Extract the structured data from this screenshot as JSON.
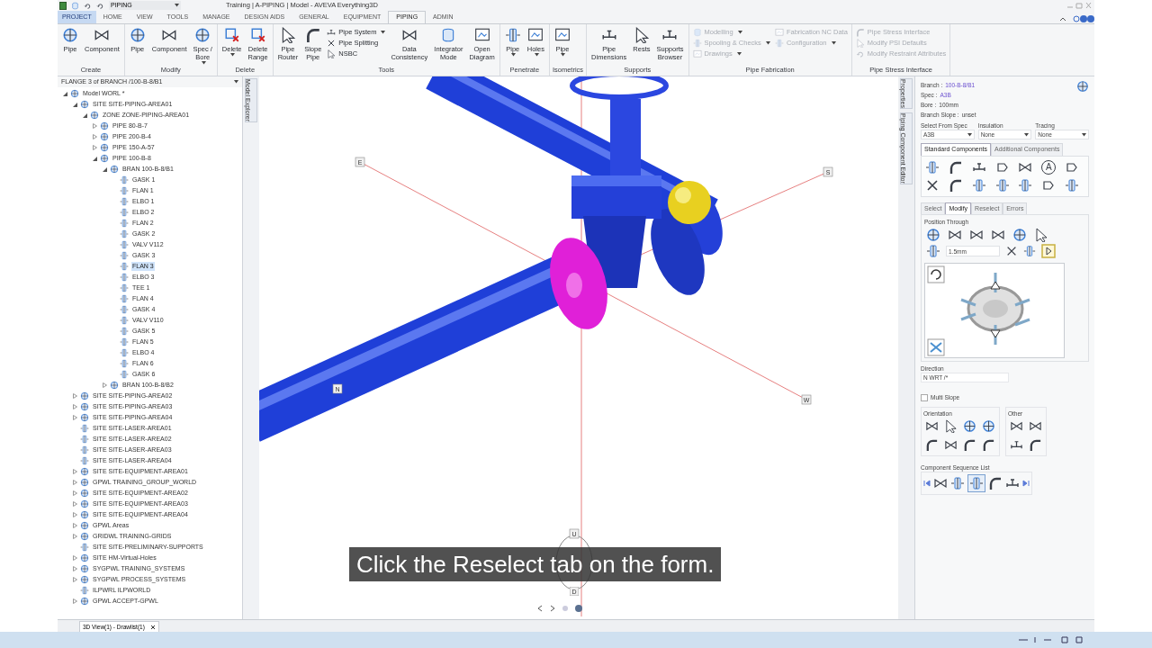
{
  "title_bar": {
    "workspace": "PIPING",
    "title": "Training | A-PIPING | Model - AVEVA Everything3D"
  },
  "tabs": [
    {
      "label": "PROJECT",
      "kind": "app"
    },
    {
      "label": "HOME",
      "kind": "tab",
      "selected": false
    },
    {
      "label": "VIEW",
      "kind": "tab",
      "selected": false
    },
    {
      "label": "TOOLS",
      "kind": "tab",
      "selected": false
    },
    {
      "label": "MANAGE",
      "kind": "tab",
      "selected": false
    },
    {
      "label": "DESIGN AIDS",
      "kind": "tab",
      "selected": false
    },
    {
      "label": "GENERAL",
      "kind": "tab",
      "selected": false
    },
    {
      "label": "EQUIPMENT",
      "kind": "tab",
      "selected": false
    },
    {
      "label": "PIPING",
      "kind": "tab",
      "selected": true
    },
    {
      "label": "ADMIN",
      "kind": "tab",
      "selected": false
    }
  ],
  "ribbon": [
    {
      "label": "Create",
      "items": [
        {
          "kind": "large",
          "label": "Pipe",
          "menu": false,
          "disabled": false
        },
        {
          "kind": "large",
          "label": "Component",
          "menu": false,
          "disabled": false
        }
      ]
    },
    {
      "label": "Modify",
      "items": [
        {
          "kind": "large",
          "label": "Pipe",
          "menu": false,
          "disabled": false
        },
        {
          "kind": "large",
          "label": "Component",
          "menu": false,
          "disabled": false
        },
        {
          "kind": "large",
          "label": "Spec /\nBore",
          "menu": true,
          "disabled": false
        }
      ]
    },
    {
      "label": "Delete",
      "items": [
        {
          "kind": "large",
          "label": "Delete",
          "menu": true,
          "disabled": false
        },
        {
          "kind": "large",
          "label": "Delete\nRange",
          "menu": false,
          "disabled": false
        }
      ]
    },
    {
      "label": "Tools",
      "items": [
        {
          "kind": "large",
          "label": "Pipe\nRouter",
          "menu": false,
          "disabled": false
        },
        {
          "kind": "large",
          "label": "Slope\nPipe",
          "menu": false,
          "disabled": false
        },
        {
          "kind": "small",
          "label": "Pipe System",
          "menu": true,
          "disabled": false
        },
        {
          "kind": "small",
          "label": "Pipe Splitting",
          "menu": false,
          "disabled": false
        },
        {
          "kind": "small",
          "label": "NSBC",
          "menu": false,
          "disabled": false
        },
        {
          "kind": "large",
          "label": "Data\nConsistency",
          "menu": false,
          "disabled": false
        },
        {
          "kind": "large",
          "label": "Integrator\nMode",
          "menu": false,
          "disabled": false
        },
        {
          "kind": "large",
          "label": "Open\nDiagram",
          "menu": false,
          "disabled": false
        }
      ]
    },
    {
      "label": "Penetrate",
      "items": [
        {
          "kind": "large",
          "label": "Pipe",
          "menu": true,
          "disabled": false
        },
        {
          "kind": "large",
          "label": "Holes",
          "menu": true,
          "disabled": false
        }
      ]
    },
    {
      "label": "Isometrics",
      "items": [
        {
          "kind": "large",
          "label": "Pipe",
          "menu": true,
          "disabled": false
        }
      ]
    },
    {
      "label": "Supports",
      "items": [
        {
          "kind": "large",
          "label": "Pipe\nDimensions",
          "menu": false,
          "disabled": false
        },
        {
          "kind": "large",
          "label": "Rests",
          "menu": false,
          "disabled": false
        },
        {
          "kind": "large",
          "label": "Supports\nBrowser",
          "menu": false,
          "disabled": false
        }
      ]
    },
    {
      "label": "Pipe Fabrication",
      "items": [
        {
          "kind": "small",
          "label": "Modelling",
          "menu": true,
          "disabled": true
        },
        {
          "kind": "small",
          "label": "Spooling & Checks",
          "menu": true,
          "disabled": true
        },
        {
          "kind": "small",
          "label": "Drawings",
          "menu": true,
          "disabled": true
        },
        {
          "kind": "small",
          "label": "Fabrication NC Data",
          "menu": false,
          "disabled": true
        },
        {
          "kind": "small",
          "label": "Configuration",
          "menu": true,
          "disabled": true
        }
      ]
    },
    {
      "label": "Pipe Stress Interface",
      "items": [
        {
          "kind": "small",
          "label": "Pipe Stress Interface",
          "menu": false,
          "disabled": true
        },
        {
          "kind": "small",
          "label": "Modify PSI Defaults",
          "menu": false,
          "disabled": true
        },
        {
          "kind": "small",
          "label": "Modify Restraint Attributes",
          "menu": false,
          "disabled": true
        }
      ]
    }
  ],
  "explorer": {
    "header": "FLANGE 3 of BRANCH /100-B-8/B1",
    "side_tab": "Model Explorer",
    "tree": [
      {
        "label": "Model WORL *",
        "kind": "branch",
        "expanded": true,
        "selected": false,
        "children": [
          {
            "label": "SITE SITE-PIPING-AREA01",
            "kind": "branch",
            "expanded": true,
            "selected": false,
            "children": [
              {
                "label": "ZONE ZONE-PIPING-AREA01",
                "kind": "branch",
                "expanded": true,
                "selected": false,
                "children": [
                  {
                    "label": "PIPE 80-B-7",
                    "kind": "branch",
                    "expanded": false,
                    "selected": false
                  },
                  {
                    "label": "PIPE 200-B-4",
                    "kind": "branch",
                    "expanded": false,
                    "selected": false
                  },
                  {
                    "label": "PIPE 150-A-57",
                    "kind": "branch",
                    "expanded": false,
                    "selected": false
                  },
                  {
                    "label": "PIPE 100-B-8",
                    "kind": "branch",
                    "expanded": true,
                    "selected": false,
                    "children": [
                      {
                        "label": "BRAN 100-B-8/B1",
                        "kind": "branch",
                        "expanded": true,
                        "selected": false,
                        "children": [
                          {
                            "label": "GASK 1",
                            "kind": "leaf",
                            "selected": false
                          },
                          {
                            "label": "FLAN 1",
                            "kind": "leaf",
                            "selected": false
                          },
                          {
                            "label": "ELBO 1",
                            "kind": "leaf",
                            "selected": false
                          },
                          {
                            "label": "ELBO 2",
                            "kind": "leaf",
                            "selected": false
                          },
                          {
                            "label": "FLAN 2",
                            "kind": "leaf",
                            "selected": false
                          },
                          {
                            "label": "GASK 2",
                            "kind": "leaf",
                            "selected": false
                          },
                          {
                            "label": "VALV V112",
                            "kind": "leaf",
                            "selected": false
                          },
                          {
                            "label": "GASK 3",
                            "kind": "leaf",
                            "selected": false
                          },
                          {
                            "label": "FLAN 3",
                            "kind": "leaf",
                            "selected": true
                          },
                          {
                            "label": "ELBO 3",
                            "kind": "leaf",
                            "selected": false
                          },
                          {
                            "label": "TEE 1",
                            "kind": "leaf",
                            "selected": false
                          },
                          {
                            "label": "FLAN 4",
                            "kind": "leaf",
                            "selected": false
                          },
                          {
                            "label": "GASK 4",
                            "kind": "leaf",
                            "selected": false
                          },
                          {
                            "label": "VALV V110",
                            "kind": "leaf",
                            "selected": false
                          },
                          {
                            "label": "GASK 5",
                            "kind": "leaf",
                            "selected": false
                          },
                          {
                            "label": "FLAN 5",
                            "kind": "leaf",
                            "selected": false
                          },
                          {
                            "label": "ELBO 4",
                            "kind": "leaf",
                            "selected": false
                          },
                          {
                            "label": "FLAN 6",
                            "kind": "leaf",
                            "selected": false
                          },
                          {
                            "label": "GASK 6",
                            "kind": "leaf",
                            "selected": false
                          }
                        ]
                      },
                      {
                        "label": "BRAN 100-B-8/B2",
                        "kind": "branch",
                        "expanded": false,
                        "selected": false
                      }
                    ]
                  }
                ]
              }
            ]
          },
          {
            "label": "SITE SITE-PIPING-AREA02",
            "kind": "branch",
            "expanded": false,
            "selected": false
          },
          {
            "label": "SITE SITE-PIPING-AREA03",
            "kind": "branch",
            "expanded": false,
            "selected": false
          },
          {
            "label": "SITE SITE-PIPING-AREA04",
            "kind": "branch",
            "expanded": false,
            "selected": false
          },
          {
            "label": "SITE SITE-LASER-AREA01",
            "kind": "leaf",
            "selected": false
          },
          {
            "label": "SITE SITE-LASER-AREA02",
            "kind": "leaf",
            "selected": false
          },
          {
            "label": "SITE SITE-LASER-AREA03",
            "kind": "leaf",
            "selected": false
          },
          {
            "label": "SITE SITE-LASER-AREA04",
            "kind": "leaf",
            "selected": false
          },
          {
            "label": "SITE SITE-EQUIPMENT-AREA01",
            "kind": "branch",
            "expanded": false,
            "selected": false
          },
          {
            "label": "GPWL TRAINING_GROUP_WORLD",
            "kind": "branch",
            "expanded": false,
            "selected": false
          },
          {
            "label": "SITE SITE-EQUIPMENT-AREA02",
            "kind": "branch",
            "expanded": false,
            "selected": false
          },
          {
            "label": "SITE SITE-EQUIPMENT-AREA03",
            "kind": "branch",
            "expanded": false,
            "selected": false
          },
          {
            "label": "SITE SITE-EQUIPMENT-AREA04",
            "kind": "branch",
            "expanded": false,
            "selected": false
          },
          {
            "label": "GPWL Areas",
            "kind": "branch",
            "expanded": false,
            "selected": false
          },
          {
            "label": "GRIDWL TRAINING-GRIDS",
            "kind": "branch",
            "expanded": false,
            "selected": false
          },
          {
            "label": "SITE SITE-PRELIMINARY-SUPPORTS",
            "kind": "leaf",
            "selected": false
          },
          {
            "label": "SITE HM-Virtual-Holes",
            "kind": "branch",
            "expanded": false,
            "selected": false
          },
          {
            "label": "SYGPWL TRAINING_SYSTEMS",
            "kind": "branch",
            "expanded": false,
            "selected": false
          },
          {
            "label": "SYGPWL PROCESS_SYSTEMS",
            "kind": "branch",
            "expanded": false,
            "selected": false
          },
          {
            "label": "ILPWRL ILPWORLD",
            "kind": "leaf",
            "selected": false
          },
          {
            "label": "GPWL ACCEPT-GPWL",
            "kind": "branch",
            "expanded": false,
            "selected": false
          }
        ]
      }
    ]
  },
  "viewport": {
    "axis_labels": [
      {
        "label": "E",
        "kind": "E"
      },
      {
        "label": "S",
        "kind": "S"
      },
      {
        "label": "W",
        "kind": "W"
      },
      {
        "label": "N",
        "kind": "N"
      },
      {
        "label": "U",
        "kind": "U"
      },
      {
        "label": "D",
        "kind": "D"
      }
    ],
    "caption": "Click the Reselect tab on the form."
  },
  "side_tabs": [
    "Properties",
    "Piping Component Editor"
  ],
  "editor": {
    "properties": [
      {
        "label": "Branch :",
        "value": "100-B-8/B1",
        "kind": "link"
      },
      {
        "label": "Spec :",
        "value": "A3B",
        "kind": "link"
      },
      {
        "label": "Bore :",
        "value": "100mm",
        "kind": "plain"
      },
      {
        "label": "Branch Slope :",
        "value": "unset",
        "kind": "plain"
      }
    ],
    "selects": [
      {
        "label": "Select From Spec",
        "value": "A3B"
      },
      {
        "label": "Insulation",
        "value": "None"
      },
      {
        "label": "Tracing",
        "value": "None"
      }
    ],
    "component_tabs": [
      {
        "label": "Standard Components",
        "selected": true
      },
      {
        "label": "Additional Components",
        "selected": false
      }
    ],
    "instrument_letter": "A",
    "mode_tabs": [
      {
        "label": "Select",
        "selected": false
      },
      {
        "label": "Modify",
        "selected": true
      },
      {
        "label": "Reselect",
        "selected": false
      },
      {
        "label": "Errors",
        "selected": false
      }
    ],
    "position_through": {
      "label": "Position Through",
      "distance": "1.5mm"
    },
    "direction": {
      "label": "Direction",
      "value": "N WRT /*"
    },
    "multi_slope": {
      "label": "Multi Slope",
      "checked": false
    },
    "orientation_label": "Orientation",
    "other_label": "Other",
    "sequence_label": "Component Sequence List"
  },
  "doc_tabs": [
    {
      "label": "3D View(1) - Drawlist(1)",
      "selected": true
    }
  ]
}
